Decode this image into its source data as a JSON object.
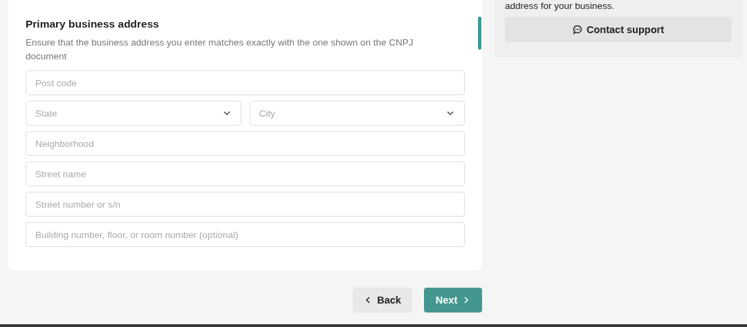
{
  "address_form": {
    "title": "Primary business address",
    "description": "Ensure that the business address you enter matches exactly with the one shown on the CNPJ document",
    "rows": [
      [
        {
          "kind": "text",
          "placeholder": "Post code"
        }
      ],
      [
        {
          "kind": "select",
          "placeholder": "State"
        },
        {
          "kind": "select",
          "placeholder": "City"
        }
      ],
      [
        {
          "kind": "text",
          "placeholder": "Neighborhood"
        }
      ],
      [
        {
          "kind": "text",
          "placeholder": "Street name"
        }
      ],
      [
        {
          "kind": "text",
          "placeholder": "Street number or s/n"
        }
      ],
      [
        {
          "kind": "text",
          "placeholder": "Building number, floor, or room number (optional)"
        }
      ]
    ]
  },
  "support_panel": {
    "text": "address for your business.",
    "button": "Contact support"
  },
  "navigation": {
    "back": "Back",
    "next": "Next"
  }
}
